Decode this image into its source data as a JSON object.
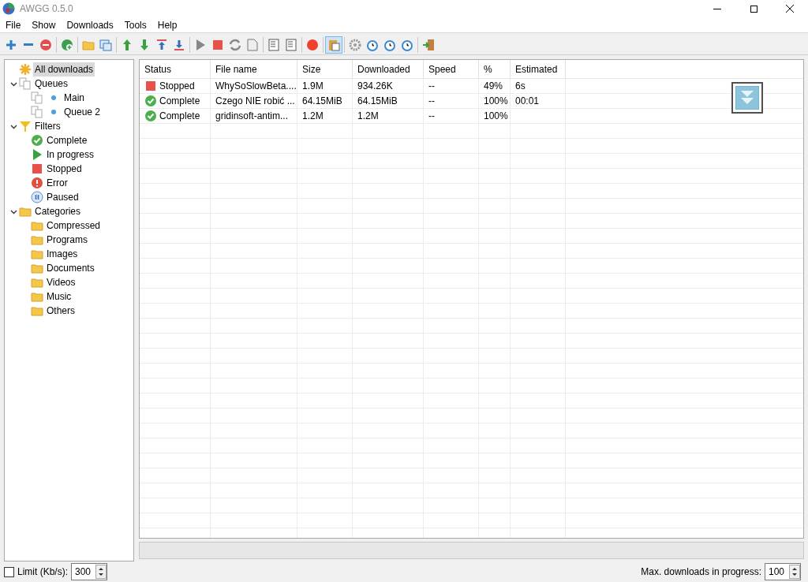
{
  "window": {
    "title": "AWGG 0.5.0"
  },
  "menu": [
    "File",
    "Show",
    "Downloads",
    "Tools",
    "Help"
  ],
  "toolbar": [
    {
      "kind": "add",
      "pressed": false
    },
    {
      "kind": "remove",
      "pressed": false
    },
    {
      "kind": "delete",
      "pressed": false
    },
    {
      "kind": "separator"
    },
    {
      "kind": "globe",
      "pressed": false
    },
    {
      "kind": "separator"
    },
    {
      "kind": "folder",
      "pressed": false
    },
    {
      "kind": "window",
      "pressed": false
    },
    {
      "kind": "separator"
    },
    {
      "kind": "up",
      "pressed": false
    },
    {
      "kind": "down",
      "pressed": false
    },
    {
      "kind": "top",
      "pressed": false
    },
    {
      "kind": "bottom",
      "pressed": false
    },
    {
      "kind": "separator"
    },
    {
      "kind": "play",
      "pressed": false
    },
    {
      "kind": "stop",
      "pressed": false
    },
    {
      "kind": "refresh",
      "pressed": false
    },
    {
      "kind": "file",
      "pressed": false
    },
    {
      "kind": "separator"
    },
    {
      "kind": "doc",
      "pressed": false
    },
    {
      "kind": "doc",
      "pressed": false
    },
    {
      "kind": "separator"
    },
    {
      "kind": "record",
      "pressed": false
    },
    {
      "kind": "separator"
    },
    {
      "kind": "clipboard",
      "pressed": true
    },
    {
      "kind": "separator"
    },
    {
      "kind": "gear",
      "pressed": false
    },
    {
      "kind": "alarm",
      "pressed": false
    },
    {
      "kind": "alarm",
      "pressed": false
    },
    {
      "kind": "alarm",
      "pressed": false
    },
    {
      "kind": "separator"
    },
    {
      "kind": "exit",
      "pressed": false
    }
  ],
  "tree": [
    {
      "label": "All downloads",
      "kind": "star",
      "selected": true
    },
    {
      "label": "Queues",
      "kind": "pages",
      "selected": false,
      "expanded": true,
      "children": [
        {
          "label": "Main",
          "kind": "queue",
          "selected": false
        },
        {
          "label": "Queue 2",
          "kind": "queue",
          "selected": false
        }
      ]
    },
    {
      "label": "Filters",
      "kind": "filter",
      "selected": false,
      "expanded": true,
      "children": [
        {
          "label": "Complete",
          "kind": "complete",
          "selected": false
        },
        {
          "label": "In progress",
          "kind": "progress",
          "selected": false
        },
        {
          "label": "Stopped",
          "kind": "stopped",
          "selected": false
        },
        {
          "label": "Error",
          "kind": "error",
          "selected": false
        },
        {
          "label": "Paused",
          "kind": "paused",
          "selected": false
        }
      ]
    },
    {
      "label": "Categories",
      "kind": "folder",
      "selected": false,
      "expanded": true,
      "children": [
        {
          "label": "Compressed",
          "kind": "folder",
          "selected": false
        },
        {
          "label": "Programs",
          "kind": "folder",
          "selected": false
        },
        {
          "label": "Images",
          "kind": "folder",
          "selected": false
        },
        {
          "label": "Documents",
          "kind": "folder",
          "selected": false
        },
        {
          "label": "Videos",
          "kind": "folder",
          "selected": false
        },
        {
          "label": "Music",
          "kind": "folder",
          "selected": false
        },
        {
          "label": "Others",
          "kind": "folder",
          "selected": false
        }
      ]
    }
  ],
  "table": {
    "columns": [
      "Status",
      "File name",
      "Size",
      "Downloaded",
      "Speed",
      "%",
      "Estimated"
    ],
    "rows": [
      {
        "kind": "stopped",
        "cells": [
          "Stopped",
          "WhySoSlowBeta....",
          "1.9M",
          "934.26K",
          "--",
          "49%",
          "6s"
        ]
      },
      {
        "kind": "complete",
        "cells": [
          "Complete",
          "Czego NIE robić ...",
          "64.15MiB",
          "64.15MiB",
          "--",
          "100%",
          "00:01"
        ]
      },
      {
        "kind": "complete",
        "cells": [
          "Complete",
          "gridinsoft-antim...",
          "1.2M",
          "1.2M",
          "--",
          "100%",
          ""
        ]
      }
    ]
  },
  "status_bar": {
    "limit_checked": false,
    "limit_label": "Limit (Kb/s):",
    "limit_value": "300",
    "max_label": "Max. downloads in progress:",
    "max_value": "100"
  }
}
